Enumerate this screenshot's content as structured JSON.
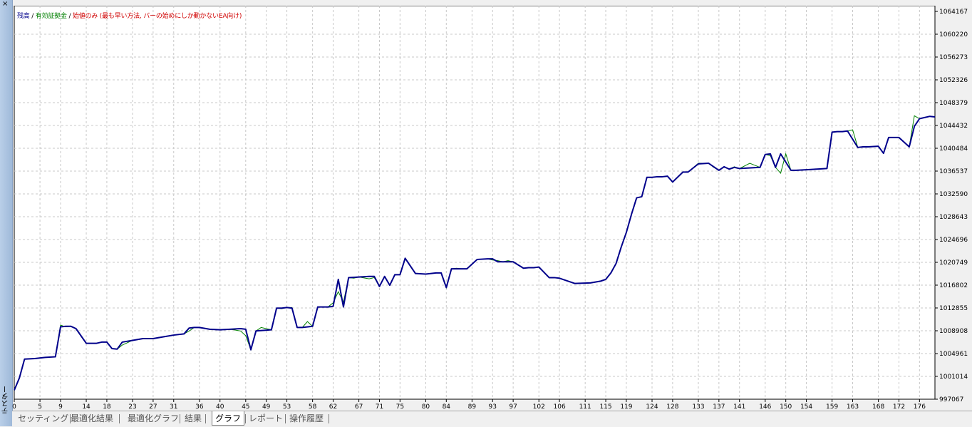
{
  "panel": {
    "title": "テスター",
    "close_glyph": "×"
  },
  "legend": {
    "items": [
      {
        "label": "残高",
        "color": "#00008b"
      },
      {
        "label": "有効証拠金",
        "color": "#008000"
      },
      {
        "label": "始値のみ (最も早い方法, バーの始めにしか動かないEA向け)",
        "color": "#d00000"
      }
    ],
    "separator": " / "
  },
  "tabs": [
    {
      "label": "セッティング",
      "active": false
    },
    {
      "label": "最適化結果",
      "active": false
    },
    {
      "label": "最適化グラフ",
      "active": false
    },
    {
      "label": "結果",
      "active": false
    },
    {
      "label": "グラフ",
      "active": true
    },
    {
      "label": "レポート",
      "active": false
    },
    {
      "label": "操作履歴",
      "active": false
    }
  ],
  "chart_data": {
    "type": "line",
    "y_ticks": [
      "1064167",
      "1060220",
      "1056273",
      "1052326",
      "1048379",
      "1044432",
      "1040484",
      "1036537",
      "1032590",
      "1028643",
      "1024696",
      "1020749",
      "1016802",
      "1012855",
      "1008908",
      "1004961",
      "1001014",
      "997067"
    ],
    "x_ticks": [
      "0",
      "5",
      "9",
      "14",
      "18",
      "23",
      "27",
      "31",
      "36",
      "40",
      "45",
      "49",
      "53",
      "58",
      "62",
      "67",
      "71",
      "75",
      "80",
      "84",
      "89",
      "93",
      "97",
      "102",
      "106",
      "111",
      "115",
      "119",
      "124",
      "128",
      "133",
      "137",
      "141",
      "146",
      "150",
      "154",
      "159",
      "163",
      "168",
      "172",
      "176"
    ],
    "x_tick_values": [
      0,
      5,
      9,
      14,
      18,
      23,
      27,
      31,
      36,
      40,
      45,
      49,
      53,
      58,
      62,
      67,
      71,
      75,
      80,
      84,
      89,
      93,
      97,
      102,
      106,
      111,
      115,
      119,
      124,
      128,
      133,
      137,
      141,
      146,
      150,
      154,
      159,
      163,
      168,
      172,
      176
    ],
    "xlim": [
      0,
      179
    ],
    "ylim": [
      997067,
      1064167
    ],
    "grid": true,
    "series": [
      {
        "name": "残高",
        "color": "#00008b",
        "x": [
          0,
          1,
          2,
          4,
          6,
          8,
          9,
          10,
          11,
          12,
          14,
          16,
          17,
          18,
          19,
          20,
          21,
          23,
          25,
          27,
          29,
          31,
          33,
          34,
          35,
          36,
          38,
          40,
          42,
          44,
          45,
          46,
          47,
          50,
          51,
          52,
          53,
          54,
          55,
          56,
          58,
          59,
          60,
          61,
          62,
          63,
          64,
          65,
          67,
          69,
          70,
          71,
          72,
          73,
          74,
          75,
          76,
          78,
          80,
          82,
          83,
          84,
          85,
          87,
          88,
          90,
          92,
          93,
          94,
          95,
          96,
          97,
          99,
          100,
          101,
          102,
          104,
          105,
          106,
          109,
          112,
          114,
          115,
          116,
          117,
          118,
          119,
          120,
          121,
          122,
          123,
          124,
          125,
          126,
          127,
          128,
          130,
          131,
          133,
          135,
          137,
          138,
          139,
          140,
          141,
          145,
          146,
          147,
          148,
          149,
          151,
          152,
          154,
          156,
          158,
          159,
          160,
          161,
          162,
          164,
          165,
          166,
          168,
          169,
          170,
          172,
          174,
          175,
          176,
          178,
          179
        ],
        "y": [
          998600,
          1000700,
          1003900,
          1004000,
          1004200,
          1004300,
          1009400,
          1009500,
          1009500,
          1009100,
          1006600,
          1006600,
          1006800,
          1006800,
          1005700,
          1005600,
          1006800,
          1007100,
          1007400,
          1007400,
          1007700,
          1008000,
          1008200,
          1009200,
          1009300,
          1009300,
          1009000,
          1008900,
          1009000,
          1009100,
          1009000,
          1005500,
          1008700,
          1008900,
          1012600,
          1012600,
          1012700,
          1012600,
          1009300,
          1009300,
          1009500,
          1012800,
          1012800,
          1012800,
          1012900,
          1017500,
          1012800,
          1017800,
          1017900,
          1018000,
          1018000,
          1016300,
          1018000,
          1016500,
          1018300,
          1018300,
          1021100,
          1018500,
          1018400,
          1018600,
          1018600,
          1016100,
          1019300,
          1019300,
          1019300,
          1020900,
          1021000,
          1021000,
          1020500,
          1020500,
          1020500,
          1020500,
          1019400,
          1019500,
          1019500,
          1019600,
          1017800,
          1017800,
          1017700,
          1016800,
          1016900,
          1017200,
          1017500,
          1018600,
          1020200,
          1023000,
          1025500,
          1028600,
          1031400,
          1031600,
          1034900,
          1034900,
          1035000,
          1035000,
          1035100,
          1034100,
          1035800,
          1035800,
          1037200,
          1037300,
          1036100,
          1036700,
          1036300,
          1036600,
          1036400,
          1036600,
          1038800,
          1038900,
          1036600,
          1038900,
          1036100,
          1036100,
          1036200,
          1036300,
          1036400,
          1042600,
          1042700,
          1042700,
          1042800,
          1040000,
          1040100,
          1040100,
          1040200,
          1039000,
          1041700,
          1041700,
          1040100,
          1043600,
          1044900,
          1045300,
          1045200
        ]
      },
      {
        "name": "有効証拠金",
        "color": "#008000",
        "x": [
          9,
          10,
          21,
          28,
          34,
          44,
          45,
          48,
          52,
          54,
          57,
          62,
          63,
          64,
          66,
          69,
          70,
          72,
          76,
          86,
          90,
          93,
          94,
          96,
          99,
          116,
          125,
          133,
          136,
          139,
          140,
          143,
          147,
          149,
          150,
          153,
          162,
          163,
          175
        ],
        "y": [
          1009700,
          1009400,
          1006300,
          1007600,
          1008700,
          1008700,
          1007900,
          1009300,
          1012500,
          1012700,
          1010300,
          1013500,
          1015400,
          1013600,
          1017700,
          1017600,
          1017800,
          1018000,
          1021000,
          1019400,
          1020900,
          1020800,
          1020700,
          1020700,
          1019400,
          1018600,
          1035000,
          1037300,
          1036600,
          1036300,
          1036700,
          1037300,
          1038600,
          1035600,
          1038900,
          1036100,
          1042800,
          1043000,
          1045400
        ]
      }
    ]
  }
}
